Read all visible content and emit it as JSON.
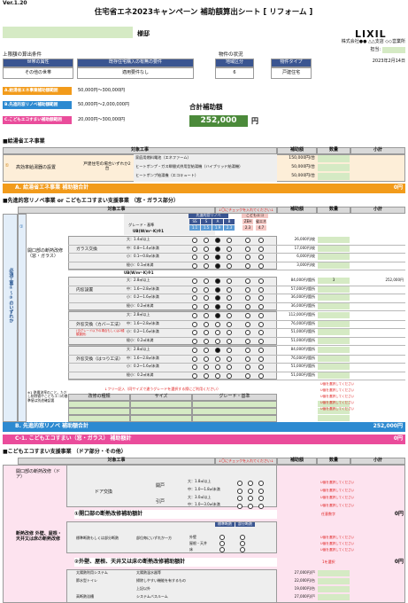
{
  "version": "Ver.1.20",
  "header": {
    "title": "住宅省エネ2023キャンペーン 補助額算出シート [ リフォーム ]",
    "logo": "LIXIL",
    "customer_suffix": "様邸",
    "company": "株式会社●● △△支店 ◇◇営業所",
    "person_label": "担当:",
    "date": "2023年2月14日"
  },
  "cond": {
    "label": "上限額の算出条件",
    "h1": "世帯の属性",
    "h2": "既存住宅購入の有無の要件",
    "v1": "その他の世帯",
    "v2": "適用要件なし",
    "status_label": "物件の状況",
    "h3": "地域区分",
    "h4": "物件タイプ",
    "v3": "6",
    "v4": "戸建住宅"
  },
  "limits": [
    {
      "label": "A.給湯省エネ事業補助額範囲",
      "range": "50,000円〜300,000円"
    },
    {
      "label": "B.先進的窓リノベ補助額範囲",
      "range": "50,000円〜2,000,000円"
    },
    {
      "label": "C.こどもエコすまい補助額範囲",
      "range": "20,000円〜300,000円"
    }
  ],
  "total": {
    "label": "合計補助額",
    "value": "252,000",
    "unit": "円"
  },
  "s1": {
    "title": "■給湯省エネ事業",
    "h_work": "対象工事",
    "h_amt": "補助額",
    "h_qty": "数量",
    "h_sub": "小計",
    "circle": "①",
    "item": "高効率給湯器の設置",
    "cond": "戸建住宅の場合いずれか2台",
    "rows": [
      {
        "name": "家庭用燃料電池（エネファーム）",
        "amt": "150,000円/台"
      },
      {
        "name": "ヒートポンプ・ガス瞬間式併用型給湯機（ハイブリッド給湯機）",
        "amt": "50,000円/台"
      },
      {
        "name": "ヒートポンプ給湯機（エコキュート）",
        "amt": "50,000円/台"
      }
    ],
    "total_label": "A. 給湯省エネ事業 補助額合計",
    "total_val": "0円"
  },
  "s2": {
    "title": "■先進的窓リノベ事業 or こどもエコすまい支援事業 （窓・ガラス部分）",
    "h_work": "対象工事",
    "check_note": "↓〇にチェックを入れてください↓",
    "h_amt": "補助額",
    "h_qty": "数量",
    "h_sub": "小計",
    "h_b": "先進的窓リノベ",
    "h_c": "こどもエコ",
    "grades": [
      "SS",
      "S",
      "A",
      "B",
      "ZEH",
      "省エネ"
    ],
    "uw": [
      "1.1",
      "1.5",
      "1.9",
      "2.3",
      "2.3",
      "4.7"
    ],
    "grade_label": "グレード・基準",
    "uw_label": "UB(W/m²･K)※1",
    "side_label": "必須工事①〜③のいずれか",
    "circle": "①",
    "item": "開口部の断熱改修（窓・ガラス）",
    "groups": [
      {
        "name": "ガラス交換",
        "rows": [
          {
            "size": "大：1.4㎡以上",
            "amt": "26,000円/枚"
          },
          {
            "size": "中：0.8〜1.4㎡未満",
            "amt": "17,000円/枚"
          },
          {
            "size": "小：0.1〜0.8㎡未満",
            "amt": "6,000円/枚"
          },
          {
            "size": "極小：0.1㎡未満",
            "amt": "3,000円/枚"
          }
        ]
      },
      {
        "name": "内窓設置",
        "rows": [
          {
            "size": "大：2.8㎡以上",
            "amt": "84,000円/箇所",
            "qty": "3",
            "sub": "252,000円"
          },
          {
            "size": "中：1.6〜2.8㎡未満",
            "amt": "57,000円/箇所"
          },
          {
            "size": "小：0.2〜1.6㎡未満",
            "amt": "36,000円/箇所"
          },
          {
            "size": "極小：0.2㎡未満",
            "amt": "36,000円/箇所"
          }
        ]
      },
      {
        "name": "外窓交換（カバー工法）",
        "note": "(当グレード以下の場合もしくは2種類選択)",
        "rows": [
          {
            "size": "大：2.8㎡以上",
            "amt": "112,000円/箇所"
          },
          {
            "size": "中：1.6〜2.8㎡未満",
            "amt": "76,000円/箇所"
          },
          {
            "size": "小：0.2〜1.6㎡未満",
            "amt": "51,000円/箇所"
          },
          {
            "size": "極小：0.2㎡未満",
            "amt": "51,000円/箇所"
          }
        ]
      },
      {
        "name": "外窓交換（はつり工法）",
        "rows": [
          {
            "size": "大：2.8㎡以上",
            "amt": "84,000円/箇所"
          },
          {
            "size": "中：1.6〜2.8㎡未満",
            "amt": "76,000円/箇所"
          },
          {
            "size": "小：0.2〜1.6㎡未満",
            "amt": "51,000円/箇所"
          },
          {
            "size": "極小：0.2㎡未満",
            "amt": "51,000円/箇所"
          }
        ]
      }
    ],
    "free_label": "↓フリー記入（同サイズで違うグレードを選択する際にご利用ください）",
    "free_h": [
      "改修の種類",
      "サイズ",
      "グレード・基準"
    ],
    "free_warn": "U値を選択してください",
    "note": "※1 熱貫流率のこと。ただし削除値やこどもエコの基準値は別途確認要",
    "total_label": "B. 先進的窓リノベ 補助額合計",
    "total_val": "252,000円",
    "ctotal_label": "C-1. こどもエコすまい（窓・ガラス） 補助額計",
    "ctotal_val": "0円"
  },
  "s3": {
    "title": "■こどもエコすまい支援事業 （ドア部分・その他）",
    "h_work": "対象工事",
    "check_note": "↓〇にチェックを入れてください↓",
    "h_amt": "補助額",
    "h_qty": "数量",
    "h_sub": "小計",
    "item1": "開口部の断熱改修（ドア）",
    "door": "ドア交換",
    "door_types": [
      "開戸",
      "引戸"
    ],
    "door_sizes": [
      "大：1.8㎡以上",
      "中：1.0〜1.8㎡未満",
      "大：3.0㎡以上",
      "中：1.0〜3.0㎡未満"
    ],
    "warn": "U値を選択してください",
    "sub1_label": "①開口部の断熱改修補助額計",
    "sub1_note": "任意数字",
    "sub1_val": "0円",
    "item2": "断熱改修 外壁、屋根・天井又は床の断熱改修",
    "item2_sub": "標準断熱もしくは部分断熱",
    "item2_sub2": "部位毎にいずれか一方",
    "parts": [
      "外壁",
      "屋根・天井",
      "床"
    ],
    "std": "標準断熱",
    "part": "部分断熱",
    "sub2_label": "②外壁、屋根、天井又は床の断熱改修補助額計",
    "sub2_note": "1を選択",
    "sub2_val": "0円",
    "item3_rows": [
      {
        "g": "太陽熱利用システム",
        "n": "太陽熱温水器等",
        "a": "27,000円/戸"
      },
      {
        "g": "節水型トイレ",
        "n": "掃除しやすい機能を有するもの",
        "a": "22,000円/台"
      },
      {
        "g": "",
        "n": "上記以外",
        "a": "19,000円/台"
      },
      {
        "g": "高断熱浴槽",
        "n": "システムバスルーム",
        "a": "27,000円/戸"
      }
    ]
  },
  "colors": {
    "navy": "#3a5591",
    "orange": "#f29b1b",
    "blue": "#2d8ad1",
    "pink": "#ea4c9b",
    "green_total": "#4b8a3a"
  },
  "icons": [
    "lixil-logo",
    "circle-radio",
    "double-circle-radio"
  ]
}
